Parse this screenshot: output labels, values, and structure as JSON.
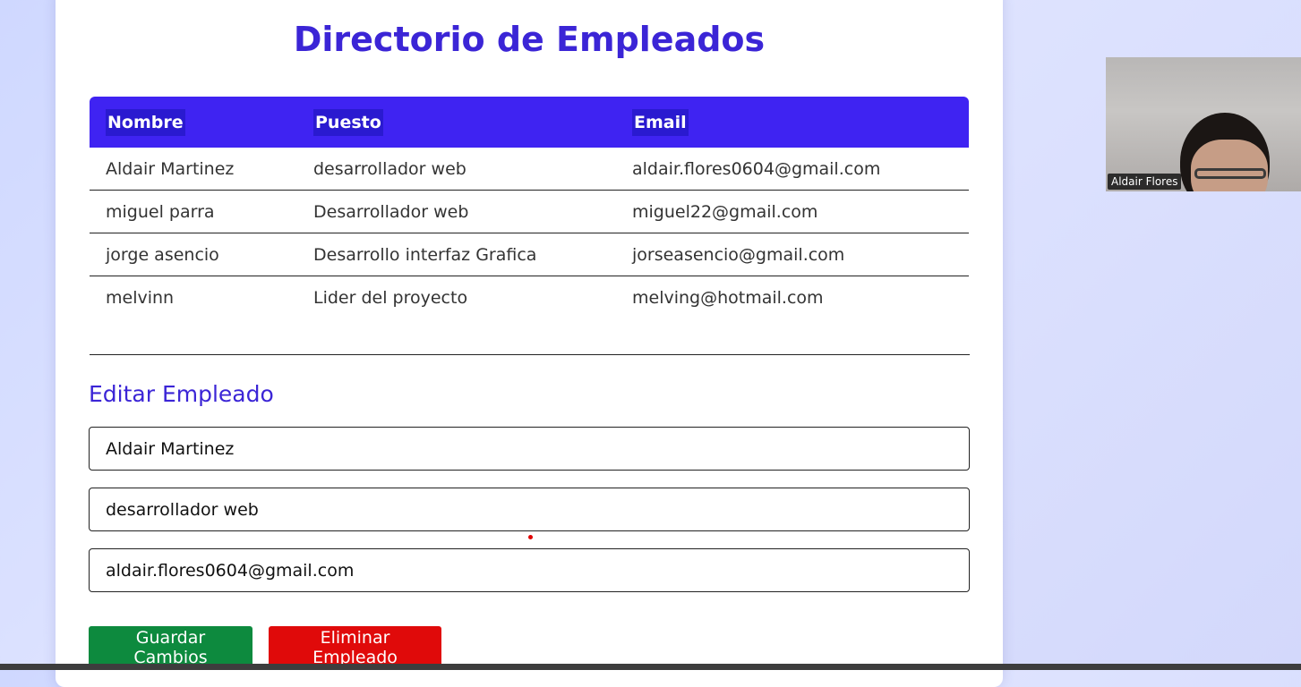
{
  "page": {
    "title": "Directorio de Empleados"
  },
  "table": {
    "headers": [
      "Nombre",
      "Puesto",
      "Email"
    ],
    "rows": [
      [
        "Aldair Martinez",
        "desarrollador web",
        "aldair.flores0604@gmail.com"
      ],
      [
        "miguel parra",
        "Desarrollador web",
        "miguel22@gmail.com"
      ],
      [
        "jorge asencio",
        "Desarrollo interfaz Grafica",
        "jorseasencio@gmail.com"
      ],
      [
        "melvinn",
        "Lider del proyecto",
        "melving@hotmail.com"
      ]
    ]
  },
  "edit": {
    "title": "Editar Empleado",
    "name_value": "Aldair Martinez",
    "position_value": "desarrollador web",
    "email_value": "aldair.flores0604@gmail.com",
    "save_label": "Guardar Cambios",
    "delete_label": "Eliminar Empleado"
  },
  "video": {
    "participant_name": "Aldair Flores"
  },
  "colors": {
    "accent": "#3b25d6",
    "header_bg": "#3f23f2",
    "save": "#0d8a3e",
    "delete": "#e00a0a"
  }
}
